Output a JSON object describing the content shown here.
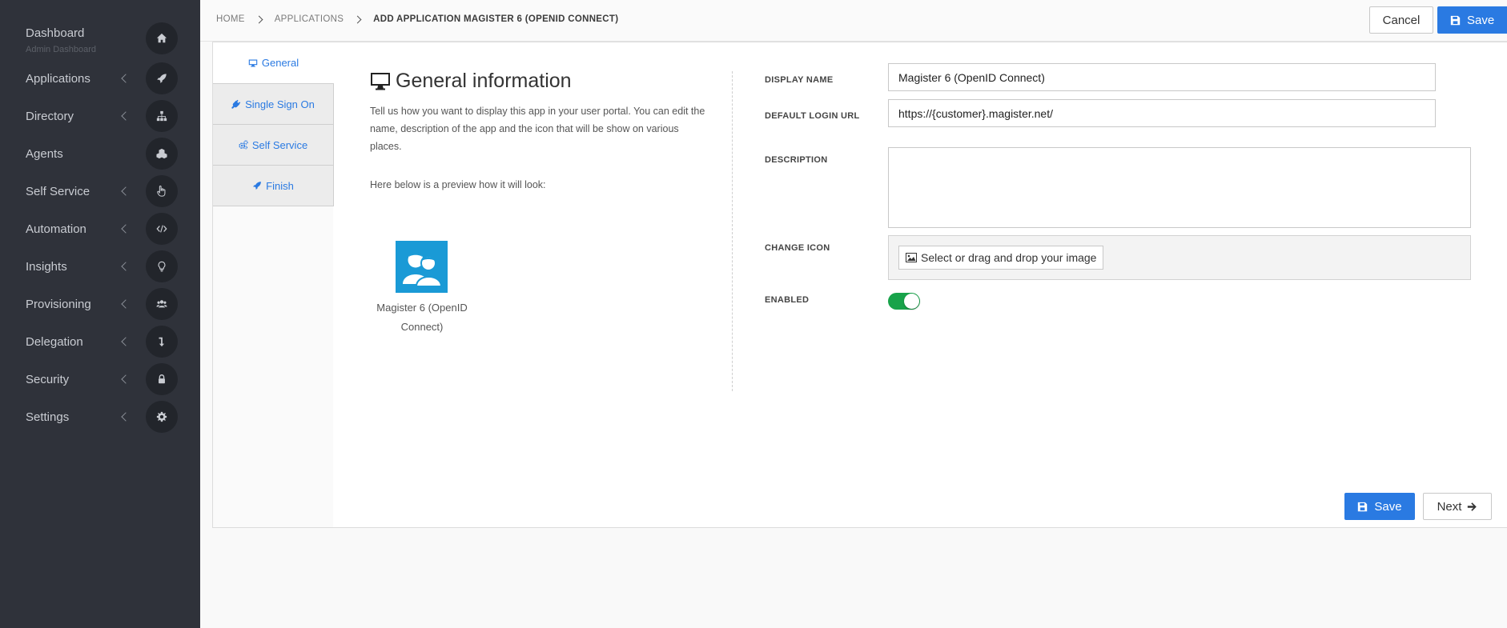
{
  "sidebar": {
    "items": [
      {
        "label": "Dashboard",
        "sub": "Admin Dashboard",
        "icon": "home-icon"
      },
      {
        "label": "Applications",
        "icon": "rocket-icon"
      },
      {
        "label": "Directory",
        "icon": "sitemap-icon"
      },
      {
        "label": "Agents",
        "icon": "cubes-icon"
      },
      {
        "label": "Self Service",
        "icon": "hand-pointer-icon"
      },
      {
        "label": "Automation",
        "icon": "code-icon"
      },
      {
        "label": "Insights",
        "icon": "lightbulb-icon"
      },
      {
        "label": "Provisioning",
        "icon": "users-icon"
      },
      {
        "label": "Delegation",
        "icon": "level-down-icon"
      },
      {
        "label": "Security",
        "icon": "lock-icon"
      },
      {
        "label": "Settings",
        "icon": "gear-icon"
      }
    ]
  },
  "breadcrumb": [
    "HOME",
    "APPLICATIONS",
    "ADD APPLICATION MAGISTER 6 (OPENID CONNECT)"
  ],
  "header": {
    "cancel": "Cancel",
    "save": "Save"
  },
  "tabs": [
    {
      "label": "General",
      "icon": "desktop-icon"
    },
    {
      "label": "Single Sign On",
      "icon": "plug-icon"
    },
    {
      "label": "Self Service",
      "icon": "cogs-icon"
    },
    {
      "label": "Finish",
      "icon": "rocket-icon"
    }
  ],
  "general": {
    "title": "General information",
    "intro": "Tell us how you want to display this app in your user portal. You can edit the name, description of the app and the icon that will be show on various places.",
    "preview_label": "Here below is a preview how it will look:",
    "app_name": "Magister 6 (OpenID Connect)"
  },
  "form": {
    "display_name_label": "DISPLAY NAME",
    "display_name": "Magister 6 (OpenID Connect)",
    "login_url_label": "DEFAULT LOGIN URL",
    "login_url": "https://{customer}.magister.net/",
    "description_label": "DESCRIPTION",
    "description": "",
    "change_icon_label": "CHANGE ICON",
    "change_icon_button": "Select or drag and drop your image",
    "enabled_label": "ENABLED",
    "enabled": true
  },
  "footer": {
    "save": "Save",
    "next": "Next"
  },
  "colors": {
    "sidebar_bg": "#2f323a",
    "primary": "#2a7ae2",
    "toggle_on": "#18a34a",
    "app_tile": "#1a9ad6"
  }
}
